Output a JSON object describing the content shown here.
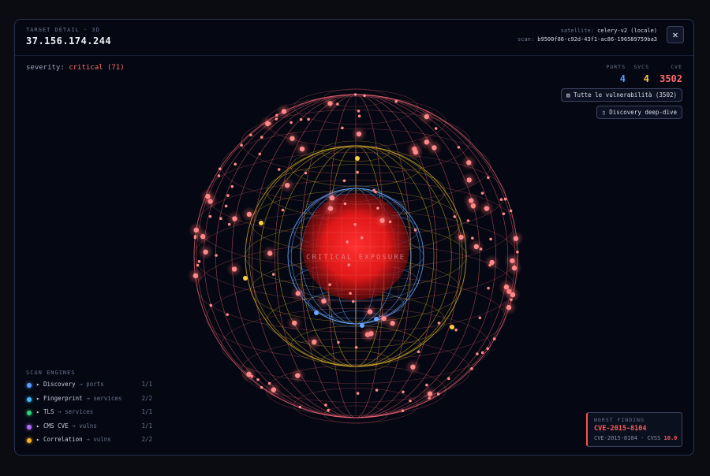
{
  "header": {
    "kicker": "TARGET DETAIL · 3D",
    "ip": "37.156.174.244",
    "satellite_label": "satellite:",
    "satellite_value": "celery-v2 (locale)",
    "scan_label": "scan:",
    "scan_value": "b9500f86-c92d-43f1-ac86-196589759ba3",
    "close_symbol": "✕"
  },
  "severity": {
    "label": "severity:",
    "value": "critical (71)",
    "color": "#ff6b6b"
  },
  "stats": [
    {
      "label": "PORTS",
      "value": "4",
      "color": "#5b9bff"
    },
    {
      "label": "SVCS",
      "value": "4",
      "color": "#ffc83d"
    },
    {
      "label": "CVE",
      "value": "3502",
      "color": "#ff6b6b"
    }
  ],
  "buttons": {
    "all_vulns": "▤ Tutte le vulnerabilità (3502)",
    "discovery": "▯ Discovery deep-dive"
  },
  "sphere": {
    "center_label": "CRITICAL EXPOSURE"
  },
  "engines": {
    "title": "SCAN ENGINES",
    "items": [
      {
        "name": "Discovery",
        "target": "ports",
        "count": "1/1",
        "color": "#5b9bff"
      },
      {
        "name": "Fingerprint",
        "target": "services",
        "count": "2/2",
        "color": "#3fb6ff"
      },
      {
        "name": "TLS",
        "target": "services",
        "count": "1/1",
        "color": "#2ed47a"
      },
      {
        "name": "CMS CVE",
        "target": "vulns",
        "count": "1/1",
        "color": "#b46cff"
      },
      {
        "name": "Correlation",
        "target": "vulns",
        "count": "2/2",
        "color": "#ffb020"
      }
    ]
  },
  "worst": {
    "label": "WORST FINDING",
    "cve": "CVE-2015-8104",
    "row_cve": "CVE-2015-8104",
    "cvss_label": "CVSS",
    "cvss_value": "10.0"
  }
}
